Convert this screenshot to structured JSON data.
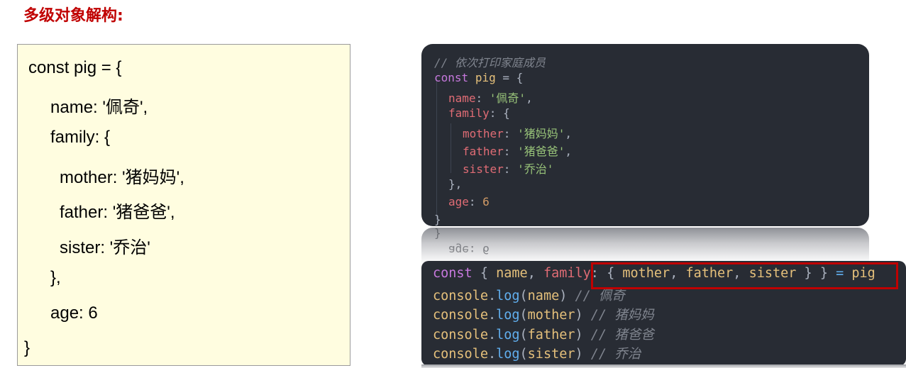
{
  "title": "多级对象解构:",
  "left_code": [
    "const pig = {",
    "name: '佩奇',",
    "family: {",
    "mother: '猪妈妈',",
    "father: '猪爸爸',",
    "sister: '乔治'",
    "},",
    "age: 6",
    "}"
  ],
  "code1": {
    "comment": "// 依次打印家庭成员",
    "l2": {
      "kw": "const",
      "var": "pig",
      "rest": " = {"
    },
    "l3": {
      "key": "name",
      "colon": ": ",
      "val": "'佩奇'",
      "end": ","
    },
    "l4": {
      "key": "family",
      "rest": ": {"
    },
    "l5": {
      "key": "mother",
      "colon": ": ",
      "val": "'猪妈妈'",
      "end": ","
    },
    "l6": {
      "key": "father",
      "colon": ": ",
      "val": "'猪爸爸'",
      "end": ","
    },
    "l7": {
      "key": "sister",
      "colon": ": ",
      "val": "'乔治'"
    },
    "l8": "},",
    "l9": {
      "key": "age",
      "colon": ": ",
      "val": "6"
    },
    "l10": "}"
  },
  "reflection": {
    "r1": "}",
    "r2": "age: 6"
  },
  "code2": {
    "d": {
      "kw": "const",
      "p1": " { ",
      "name": "name",
      "c1": ", ",
      "family": "family",
      "p2": ": { ",
      "mother": "mother",
      "c2": ", ",
      "father": "father",
      "c3": ", ",
      "sister": "sister",
      "p3": " } } ",
      "eq": "=",
      "sp": " ",
      "pig": "pig"
    },
    "logs": [
      {
        "obj": "console",
        "dot": ".",
        "fn": "log",
        "open": "(",
        "arg": "name",
        "close": ")",
        "cm": " // 佩奇"
      },
      {
        "obj": "console",
        "dot": ".",
        "fn": "log",
        "open": "(",
        "arg": "mother",
        "close": ")",
        "cm": " // 猪妈妈"
      },
      {
        "obj": "console",
        "dot": ".",
        "fn": "log",
        "open": "(",
        "arg": "father",
        "close": ")",
        "cm": " // 猪爸爸"
      },
      {
        "obj": "console",
        "dot": ".",
        "fn": "log",
        "open": "(",
        "arg": "sister",
        "close": ")",
        "cm": " // 乔治"
      }
    ]
  },
  "colors": {
    "title": "#c00000",
    "keyword": "#c678dd",
    "variable": "#e5c07b",
    "property": "#e06c75",
    "string": "#98c379",
    "number": "#d19a66",
    "function": "#61afef",
    "comment": "#7f848e",
    "highlight": "#c00000",
    "code_bg": "#282c34",
    "note_bg": "#fffde0"
  }
}
